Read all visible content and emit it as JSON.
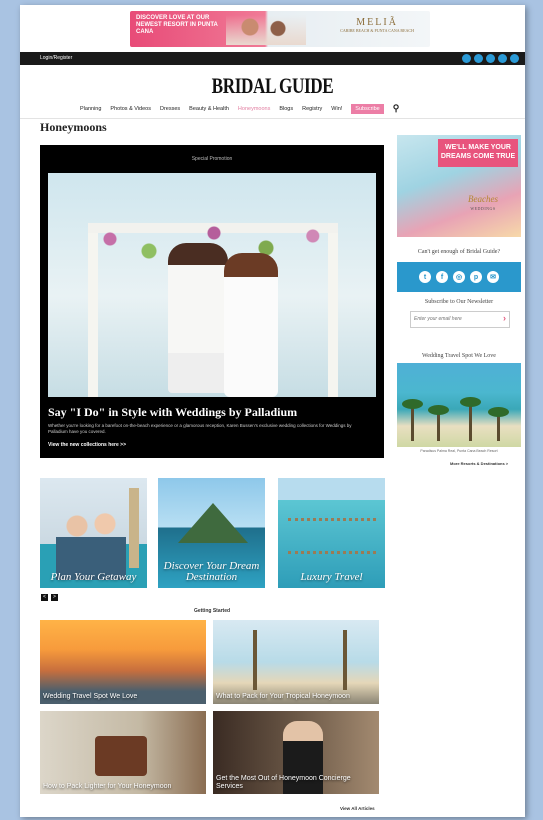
{
  "top_ad": {
    "left_text": "DISCOVER LOVE AT OUR NEWEST RESORT IN PUNTA CANA",
    "brand": "MELIÃ",
    "brand_sub": "CARIBE BEACH & PUNTA CANA BEACH"
  },
  "topbar": {
    "login": "Login/Register"
  },
  "logo": "BRIDAL GUIDE",
  "nav": {
    "items": [
      "Planning",
      "Photos & Videos",
      "Dresses",
      "Beauty & Health",
      "Honeymoons",
      "Blogs",
      "Registry",
      "Win!"
    ],
    "subscribe": "Subscribe"
  },
  "page_title": "Honeymoons",
  "feature": {
    "promo_label": "Special Promotion",
    "title": "Say \"I Do\" in Style with Weddings by Palladium",
    "description": "Whether you're looking for a barefoot on-the-beach experience or a glamorous reception, Karen Bussen's exclusive wedding collections for Weddings by Palladium have you covered.",
    "cta": "View the new collections here >>"
  },
  "sidebar": {
    "ad_banner": "WE'LL MAKE YOUR DREAMS COME TRUE",
    "ad_script": "Beaches",
    "ad_script_sub": "WEDDINGS",
    "social_title": "Can't get enough of Bridal Guide?",
    "social_icons": [
      "twitter-icon",
      "facebook-icon",
      "instagram-icon",
      "pinterest-icon",
      "email-icon"
    ],
    "social_glyphs": [
      "t",
      "f",
      "◎",
      "p",
      "✉"
    ],
    "newsletter_title": "Subscribe to Our Newsletter",
    "email_placeholder": "Enter your email here",
    "spot_title": "Wedding Travel Spot We Love",
    "spot_caption": "Paradisus Palma Real, Punta Cana Beach Resort",
    "spot_more": "More Resorts & Destinations >"
  },
  "carousel": {
    "cards": [
      {
        "label": "Plan Your Getaway"
      },
      {
        "label": "Discover Your Dream Destination"
      },
      {
        "label": "Luxury Travel"
      }
    ],
    "prev": "<",
    "next": ">"
  },
  "getting_started": {
    "title": "Getting Started",
    "tiles": [
      {
        "caption": "Wedding Travel Spot We Love"
      },
      {
        "caption": "What to Pack for Your Tropical Honeymoon"
      },
      {
        "caption": "How to Pack Lighter for Your Honeymoon"
      },
      {
        "caption": "Get the Most Out of Honeymoon Concierge Services"
      }
    ],
    "view_all": "View All Articles"
  }
}
